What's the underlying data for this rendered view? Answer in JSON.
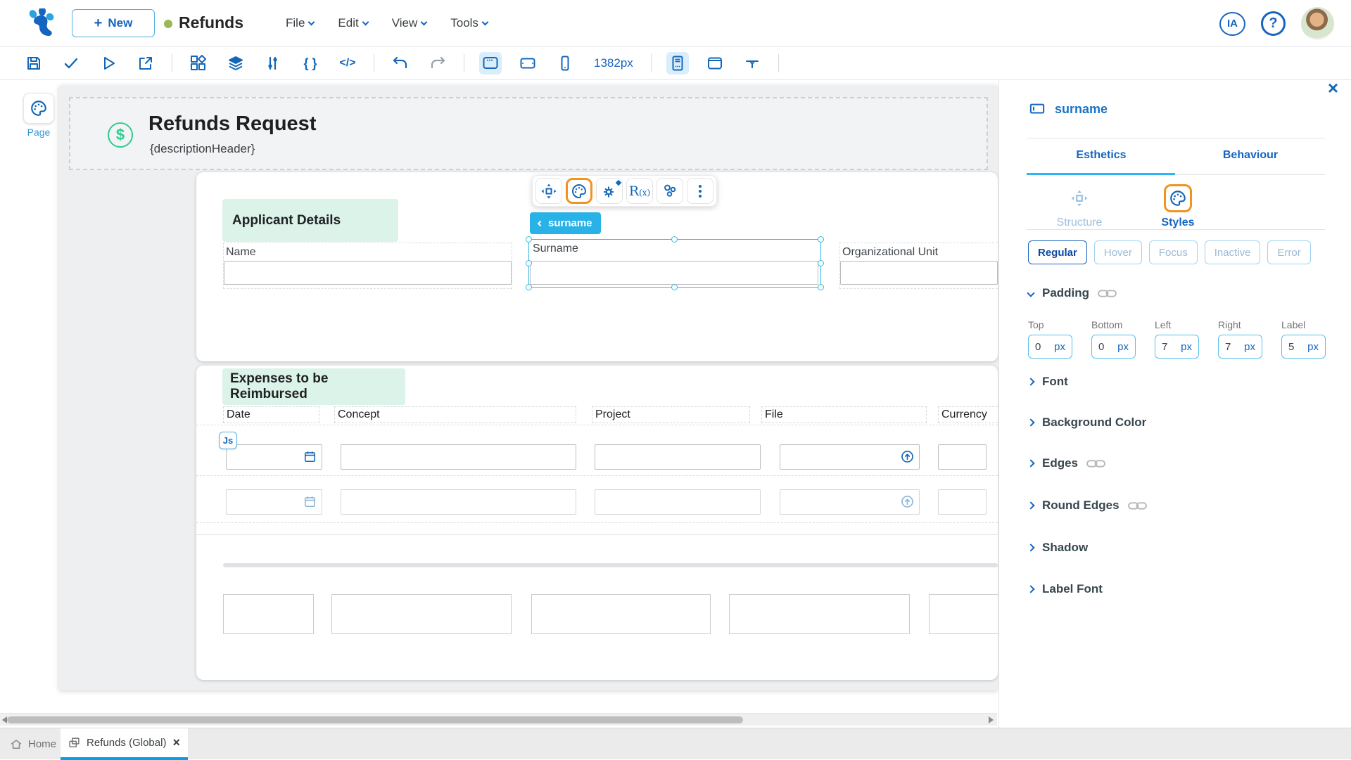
{
  "colors": {
    "primary_blue": "#1565c0",
    "accent_cyan": "#29b6f6",
    "highlight_orange": "#f0941f",
    "success_green": "#2ecc8e",
    "section_highlight_green": "#dcf3e9",
    "status_dot_green": "#9cb857"
  },
  "header": {
    "new_button_label": "New",
    "new_button_plus": "+",
    "project_name": "Refunds",
    "menus": [
      {
        "label": "File"
      },
      {
        "label": "Edit"
      },
      {
        "label": "View"
      },
      {
        "label": "Tools"
      }
    ],
    "ai_badge_label": "IA",
    "help_label": "?"
  },
  "toolbar": {
    "viewport_width_label": "1382px",
    "braces_glyph": "{ }",
    "code_glyph": "</>"
  },
  "left_rail": {
    "page_button_label": "Page"
  },
  "canvas": {
    "page_title": "Refunds Request",
    "page_subtitle": "{descriptionHeader}",
    "currency_glyph": "$",
    "applicant": {
      "section_title": "Applicant Details",
      "fields": [
        {
          "label": "Name"
        },
        {
          "label": "Surname"
        },
        {
          "label": "Organizational Unit"
        }
      ]
    },
    "selection_chip_label": "surname",
    "floating_toolbar": {
      "rx_label": "R",
      "rx_sub": "(x)"
    },
    "expenses": {
      "section_title": "Expenses to be Reimbursed",
      "js_badge_label": "Js",
      "columns": [
        {
          "label": "Date"
        },
        {
          "label": "Concept"
        },
        {
          "label": "Project"
        },
        {
          "label": "File"
        },
        {
          "label": "Currency"
        }
      ]
    }
  },
  "inspector": {
    "close_glyph": "×",
    "selected_element": "surname",
    "tabs": [
      {
        "label": "Esthetics"
      },
      {
        "label": "Behaviour"
      }
    ],
    "views": [
      {
        "label": "Structure"
      },
      {
        "label": "Styles"
      }
    ],
    "states": [
      {
        "label": "Regular"
      },
      {
        "label": "Hover"
      },
      {
        "label": "Focus"
      },
      {
        "label": "Inactive"
      },
      {
        "label": "Error"
      }
    ],
    "padding": {
      "section_title": "Padding",
      "fields": [
        {
          "label": "Top",
          "value": "0",
          "unit": "px"
        },
        {
          "label": "Bottom",
          "value": "0",
          "unit": "px"
        },
        {
          "label": "Left",
          "value": "7",
          "unit": "px"
        },
        {
          "label": "Right",
          "value": "7",
          "unit": "px"
        },
        {
          "label": "Label",
          "value": "5",
          "unit": "px"
        }
      ]
    },
    "sections": [
      {
        "label": "Font"
      },
      {
        "label": "Background Color"
      },
      {
        "label": "Edges"
      },
      {
        "label": "Round Edges"
      },
      {
        "label": "Shadow"
      },
      {
        "label": "Label Font"
      }
    ]
  },
  "footer": {
    "home_tab_label": "Home",
    "active_tab_label": "Refunds (Global)",
    "close_glyph": "×"
  }
}
